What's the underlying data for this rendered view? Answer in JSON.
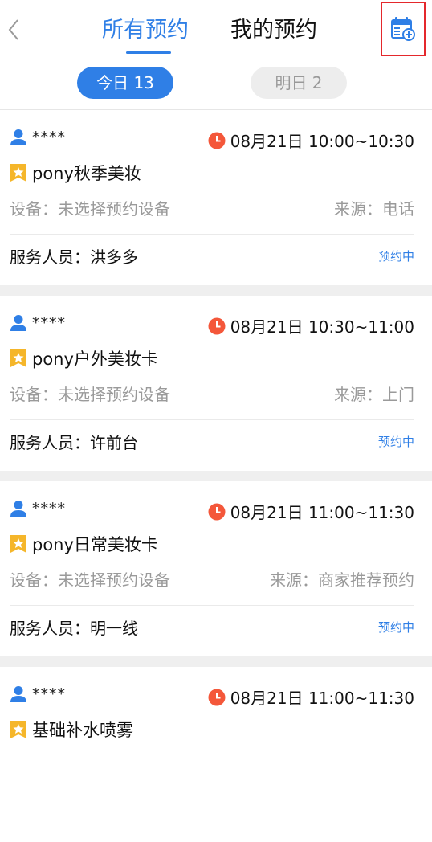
{
  "header": {
    "tabs": [
      {
        "label": "所有预约",
        "active": true
      },
      {
        "label": "我的预约",
        "active": false
      }
    ],
    "back_icon": "chevron-left-icon",
    "calendar_icon": "calendar-add-icon"
  },
  "day_filters": [
    {
      "label": "今日 13",
      "active": true
    },
    {
      "label": "明日 2",
      "active": false
    }
  ],
  "appointments": [
    {
      "customer": "****",
      "time": "08月21日 10:00~10:30",
      "service": "pony秋季美妆",
      "device": "设备：未选择预约设备",
      "source": "来源：电话",
      "staff": "服务人员：洪多多",
      "status": "预约中"
    },
    {
      "customer": "****",
      "time": "08月21日 10:30~11:00",
      "service": "pony户外美妆卡",
      "device": "设备：未选择预约设备",
      "source": "来源：上门",
      "staff": "服务人员：许前台",
      "status": "预约中"
    },
    {
      "customer": "****",
      "time": "08月21日 11:00~11:30",
      "service": "pony日常美妆卡",
      "device": "设备：未选择预约设备",
      "source": "来源：商家推荐预约",
      "staff": "服务人员：明一线",
      "status": "预约中"
    },
    {
      "customer": "****",
      "time": "08月21日 11:00~11:30",
      "service": "基础补水喷雾",
      "device": "",
      "source": "",
      "staff": "",
      "status": ""
    }
  ],
  "colors": {
    "accent": "#2f7fe6",
    "clock": "#f4573a",
    "badge": "#f5b62a",
    "highlight_box": "#e4282c"
  }
}
